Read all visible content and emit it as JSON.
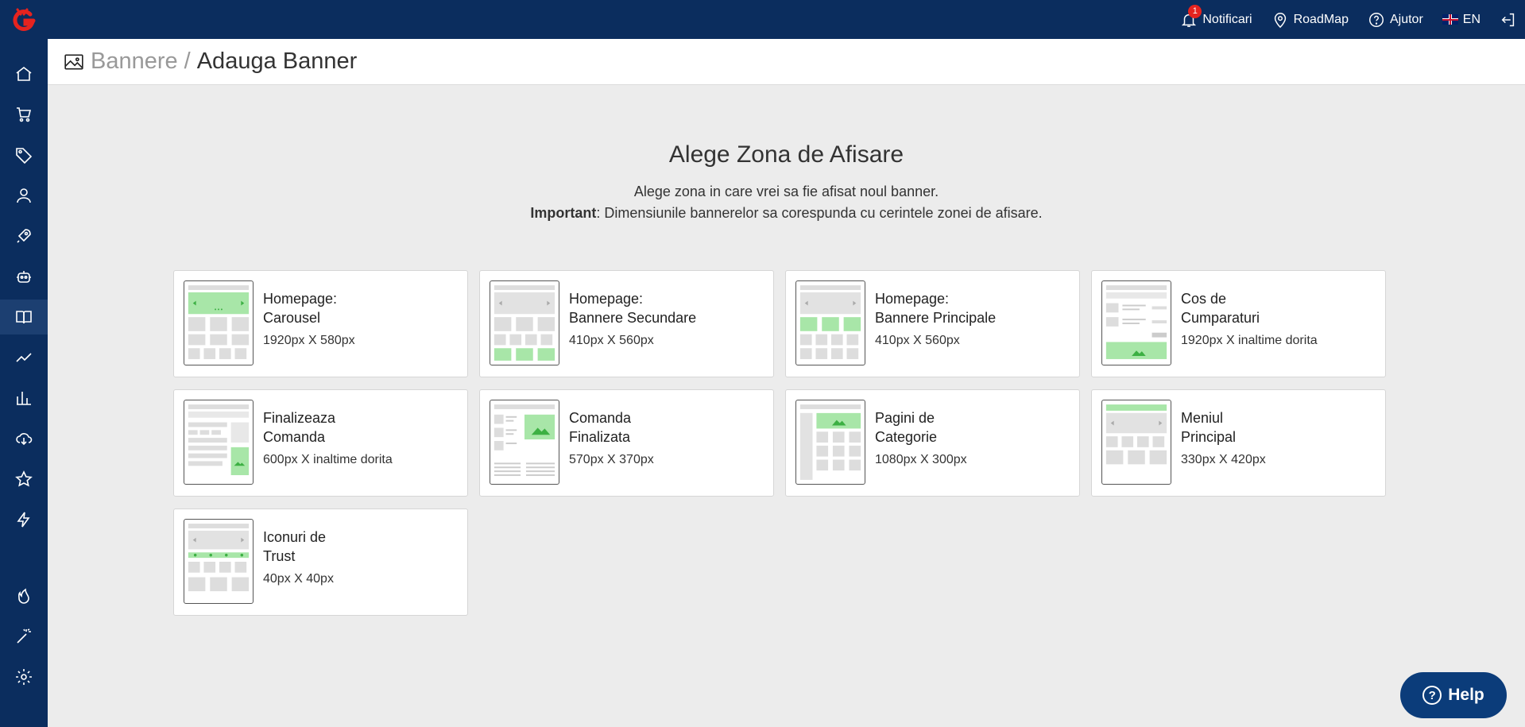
{
  "topbar": {
    "notifications_label": "Notificari",
    "notifications_count": "1",
    "roadmap_label": "RoadMap",
    "help_label": "Ajutor",
    "language_label": "EN"
  },
  "header": {
    "breadcrumb_parent": "Bannere",
    "breadcrumb_separator": "/",
    "breadcrumb_current": "Adauga Banner"
  },
  "intro": {
    "title": "Alege Zona de Afisare",
    "line1": "Alege zona in care vrei sa fie afisat noul banner.",
    "important_label": "Important",
    "line2_rest": ": Dimensiunile bannerelor sa corespunda cu cerintele zonei de afisare."
  },
  "cards": [
    {
      "title_line1": "Homepage:",
      "title_line2": "Carousel",
      "size": "1920px X 580px"
    },
    {
      "title_line1": "Homepage:",
      "title_line2": "Bannere Secundare",
      "size": "410px X 560px"
    },
    {
      "title_line1": "Homepage:",
      "title_line2": "Bannere Principale",
      "size": "410px X 560px"
    },
    {
      "title_line1": "Cos de",
      "title_line2": "Cumparaturi",
      "size": "1920px X inaltime dorita"
    },
    {
      "title_line1": "Finalizeaza",
      "title_line2": "Comanda",
      "size": "600px X inaltime dorita"
    },
    {
      "title_line1": "Comanda",
      "title_line2": "Finalizata",
      "size": "570px X 370px"
    },
    {
      "title_line1": "Pagini de",
      "title_line2": "Categorie",
      "size": "1080px X 300px"
    },
    {
      "title_line1": "Meniul",
      "title_line2": "Principal",
      "size": "330px X 420px"
    },
    {
      "title_line1": "Iconuri de",
      "title_line2": "Trust",
      "size": "40px X 40px"
    }
  ],
  "help_button": {
    "label": "Help"
  },
  "colors": {
    "topbar": "#0b2d5e",
    "accent_green": "#a8e6a8",
    "help": "#0b3c7a",
    "badge": "#e5231f"
  }
}
